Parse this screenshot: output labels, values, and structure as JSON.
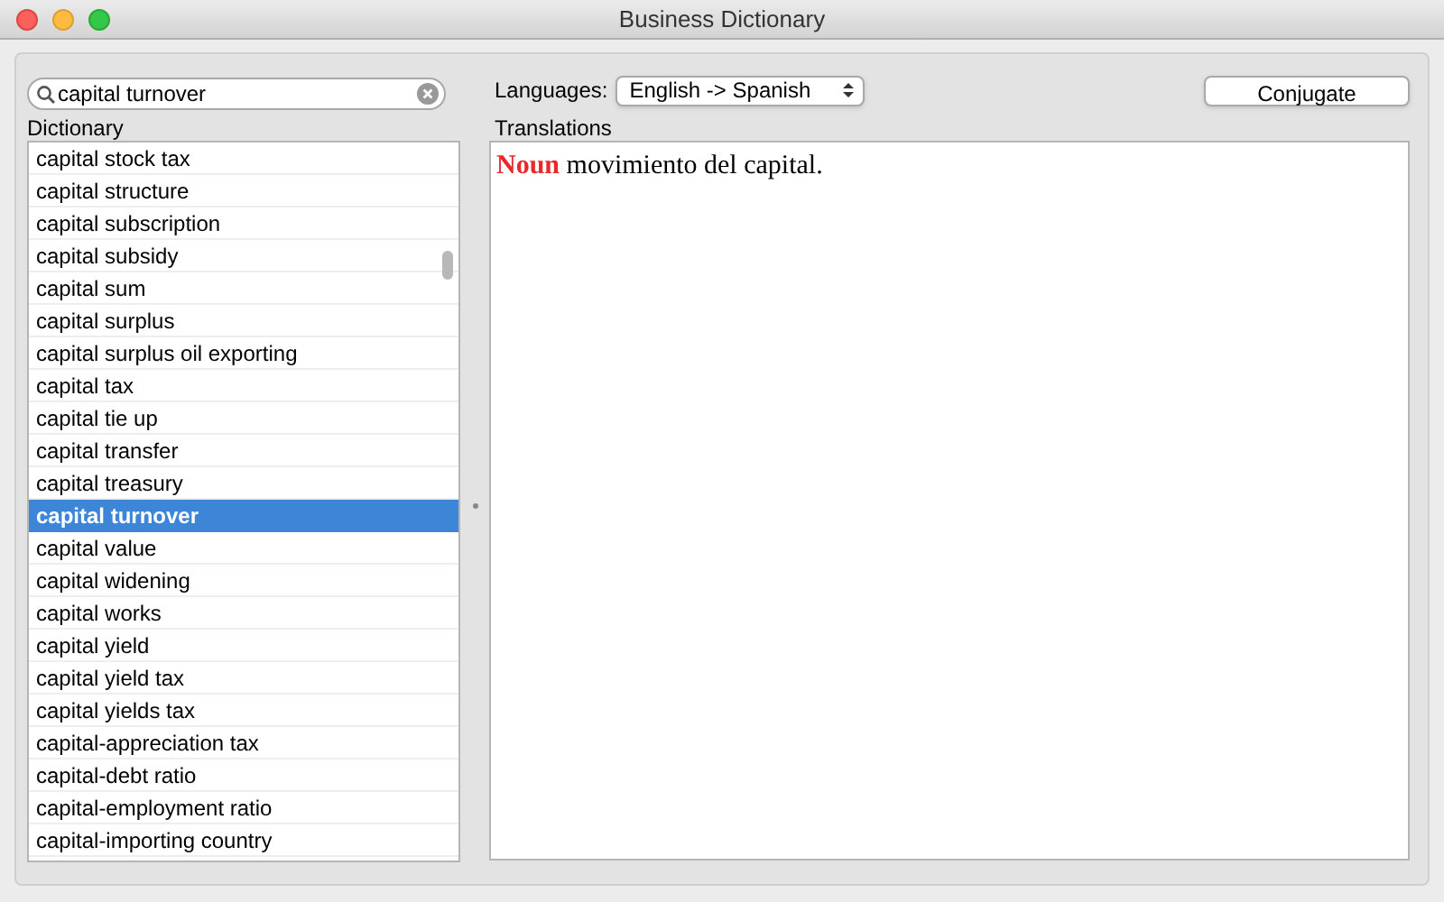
{
  "window": {
    "title": "Business Dictionary"
  },
  "search": {
    "value": "capital turnover"
  },
  "dictionary": {
    "label": "Dictionary",
    "items": [
      {
        "text": "capital stock tax",
        "selected": false
      },
      {
        "text": "capital structure",
        "selected": false
      },
      {
        "text": "capital subscription",
        "selected": false
      },
      {
        "text": "capital subsidy",
        "selected": false
      },
      {
        "text": "capital sum",
        "selected": false
      },
      {
        "text": "capital surplus",
        "selected": false
      },
      {
        "text": "capital surplus oil exporting",
        "selected": false
      },
      {
        "text": "capital tax",
        "selected": false
      },
      {
        "text": "capital tie up",
        "selected": false
      },
      {
        "text": "capital transfer",
        "selected": false
      },
      {
        "text": "capital treasury",
        "selected": false
      },
      {
        "text": "capital turnover",
        "selected": true
      },
      {
        "text": "capital value",
        "selected": false
      },
      {
        "text": "capital widening",
        "selected": false
      },
      {
        "text": "capital works",
        "selected": false
      },
      {
        "text": "capital yield",
        "selected": false
      },
      {
        "text": "capital yield tax",
        "selected": false
      },
      {
        "text": "capital yields tax",
        "selected": false
      },
      {
        "text": "capital-appreciation tax",
        "selected": false
      },
      {
        "text": "capital-debt ratio",
        "selected": false
      },
      {
        "text": "capital-employment ratio",
        "selected": false
      },
      {
        "text": "capital-importing country",
        "selected": false
      }
    ]
  },
  "languages": {
    "label": "Languages:",
    "value": "English -> Spanish"
  },
  "conjugate_button": "Conjugate",
  "translations": {
    "label": "Translations",
    "text": "**Noun** movimiento del capital."
  }
}
